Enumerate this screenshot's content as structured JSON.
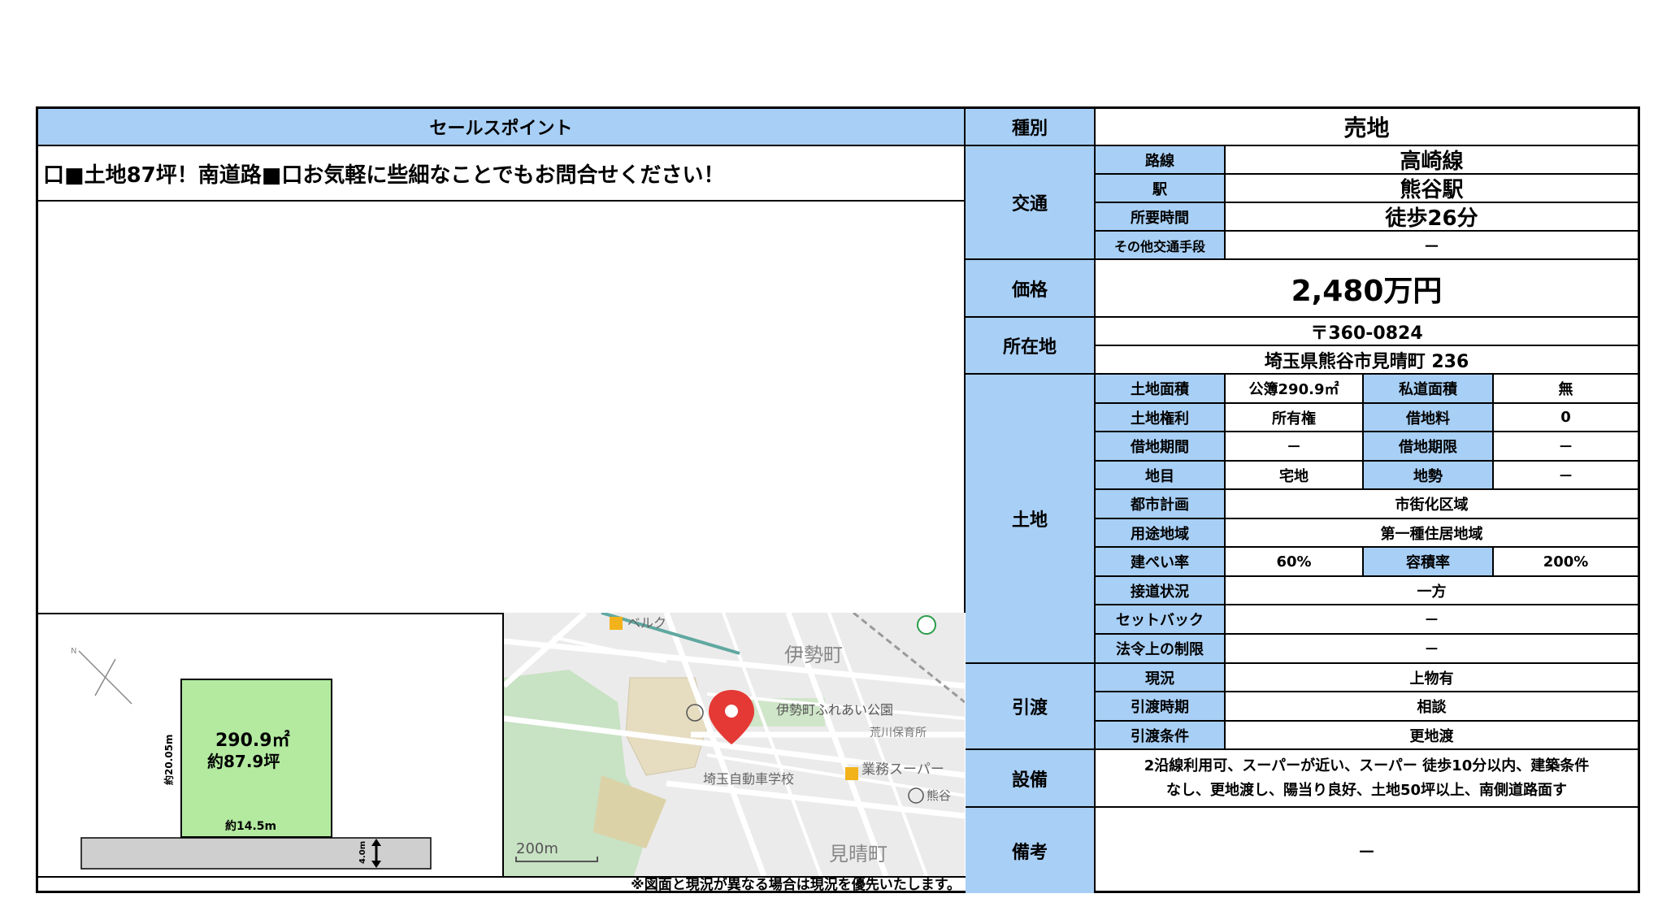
{
  "sales": {
    "header": "セールスポイント",
    "headline": "口■土地87坪！南道路■口お気軽に些細なことでもお問合せください！"
  },
  "kind": {
    "label": "種別",
    "value": "売地"
  },
  "transport": {
    "label": "交通",
    "rows": [
      {
        "label": "路線",
        "value": "高崎線"
      },
      {
        "label": "駅",
        "value": "熊谷駅"
      },
      {
        "label": "所要時間",
        "value": "徒歩26分"
      },
      {
        "label": "その他交通手段",
        "value": "－"
      }
    ]
  },
  "price": {
    "label": "価格",
    "value": "2,480万円"
  },
  "location": {
    "label": "所在地",
    "postal": "〒360-0824",
    "address": "埼玉県熊谷市見晴町 236"
  },
  "land": {
    "label": "土地",
    "area_label": "土地面積",
    "area_value": "公簿290.9㎡",
    "private_road_label": "私道面積",
    "private_road_value": "無",
    "right_label": "土地権利",
    "right_value": "所有権",
    "rent_label": "借地料",
    "rent_value": "0",
    "lease_period_label": "借地期間",
    "lease_period_value": "－",
    "lease_limit_label": "借地期限",
    "lease_limit_value": "－",
    "category_label": "地目",
    "category_value": "宅地",
    "terrain_label": "地勢",
    "terrain_value": "－",
    "city_plan_label": "都市計画",
    "city_plan_value": "市街化区域",
    "zoning_label": "用途地域",
    "zoning_value": "第一種住居地域",
    "coverage_label": "建ぺい率",
    "coverage_value": "60%",
    "far_label": "容積率",
    "far_value": "200%",
    "road_label": "接道状況",
    "road_value": "一方",
    "setback_label": "セットバック",
    "setback_value": "－",
    "legal_label": "法令上の制限",
    "legal_value": "－"
  },
  "handover": {
    "label": "引渡",
    "current_label": "現況",
    "current_value": "上物有",
    "timing_label": "引渡時期",
    "timing_value": "相談",
    "condition_label": "引渡条件",
    "condition_value": "更地渡"
  },
  "facilities": {
    "label": "設備",
    "line1": "2沿線利用可、スーパーが近い、スーパー 徒歩10分以内、建築条件",
    "line2": "なし、更地渡し、陽当り良好、土地50坪以上、南側道路面す"
  },
  "remarks": {
    "label": "備考",
    "value": "－"
  },
  "plot": {
    "area_m2": "290.9㎡",
    "area_tsubo": "約87.9坪",
    "depth": "約20.05m",
    "width": "約14.5m",
    "road": "4.0m"
  },
  "map": {
    "labels": {
      "town1": "伊勢町",
      "park": "伊勢町ふれあい公園",
      "nursery": "荒川保育所",
      "school": "埼玉自動車学校",
      "super": "業務スーパー",
      "town2": "見晴町",
      "bell": "ベルク",
      "kuma": "熊谷",
      "scale": "200m"
    }
  },
  "disclaimer": "※図面と現況が異なる場合は現況を優先いたします。"
}
